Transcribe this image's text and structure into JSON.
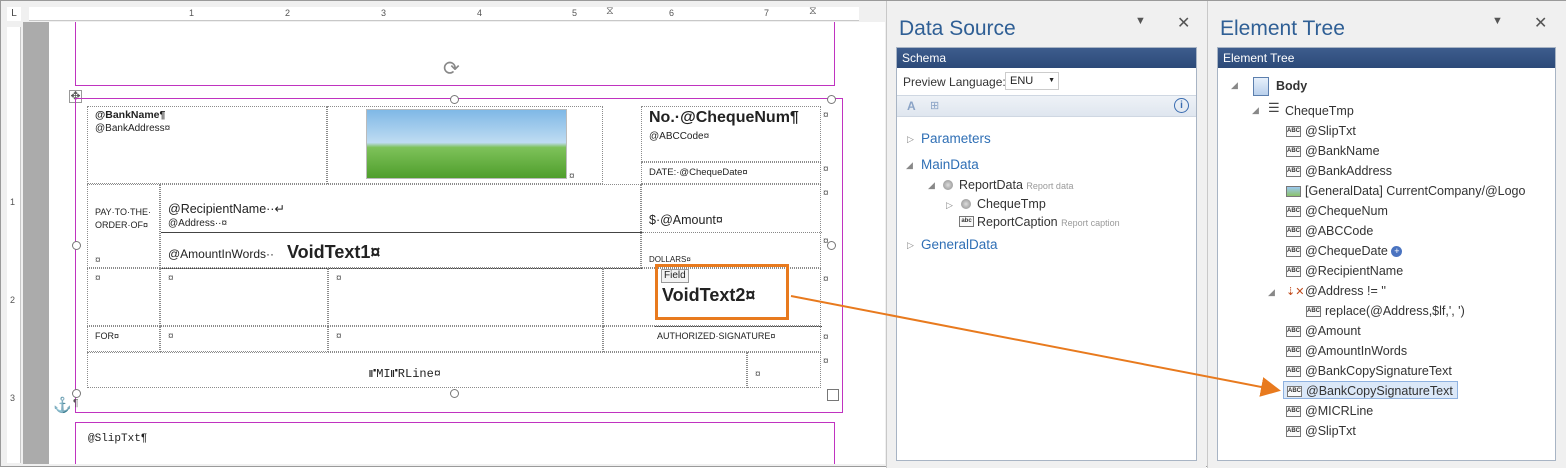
{
  "ruler": {
    "corner": "L",
    "h_numbers": [
      "1",
      "2",
      "3",
      "4",
      "5",
      "6",
      "7"
    ],
    "v_numbers": [
      "1",
      "2",
      "3"
    ]
  },
  "doc": {
    "top_band_text": "",
    "bank_name": "@BankName¶",
    "bank_address": "@BankAddress¤",
    "cheque_num": "No.·@ChequeNum¶",
    "abc_code": "@ABCCode¤",
    "date": "DATE:·@ChequeDate¤",
    "pay_to": "PAY·TO·THE·",
    "order_of": "ORDER·OF¤",
    "recipient": "@RecipientName··↵",
    "address": "@Address··¤",
    "amount": "$·@Amount¤",
    "amount_words": "@AmountInWords··",
    "void1": "VoidText1¤",
    "dollars": "DOLLARS¤",
    "field_tag": "Field",
    "void2": "VoidText2¤",
    "for": "FOR¤",
    "auth_sig": "AUTHORIZED·SIGNATURE¤",
    "micr": "⑈MI⑈RLine¤",
    "slip": "@SlipTxt¶",
    "pilcrow": "¶",
    "cellmark": "¤"
  },
  "data_source": {
    "title": "Data Source",
    "schema_header": "Schema",
    "preview_label": "Preview Language:",
    "preview_value": "ENU",
    "items": [
      {
        "label": "Parameters"
      },
      {
        "label": "MainData"
      },
      {
        "label": "ReportData",
        "note": "Report data"
      },
      {
        "label": "ChequeTmp"
      },
      {
        "label": "ReportCaption",
        "note": "Report caption"
      },
      {
        "label": "GeneralData"
      }
    ]
  },
  "element_tree": {
    "title": "Element Tree",
    "header": "Element Tree",
    "body": "Body",
    "group": "ChequeTmp",
    "items": [
      "@SlipTxt",
      "@BankName",
      "@BankAddress",
      "[GeneralData] CurrentCompany/@Logo",
      "@ChequeNum",
      "@ABCCode",
      "@ChequeDate",
      "@RecipientName",
      "@Address != ''",
      "replace(@Address,$lf,', ')",
      "@Amount",
      "@AmountInWords",
      "@BankCopySignatureText",
      "@BankCopySignatureText",
      "@MICRLine",
      "@SlipTxt"
    ]
  },
  "colors": {
    "arrow": "#e87a1e",
    "band": "#c033c0",
    "title": "#2f5f95"
  }
}
